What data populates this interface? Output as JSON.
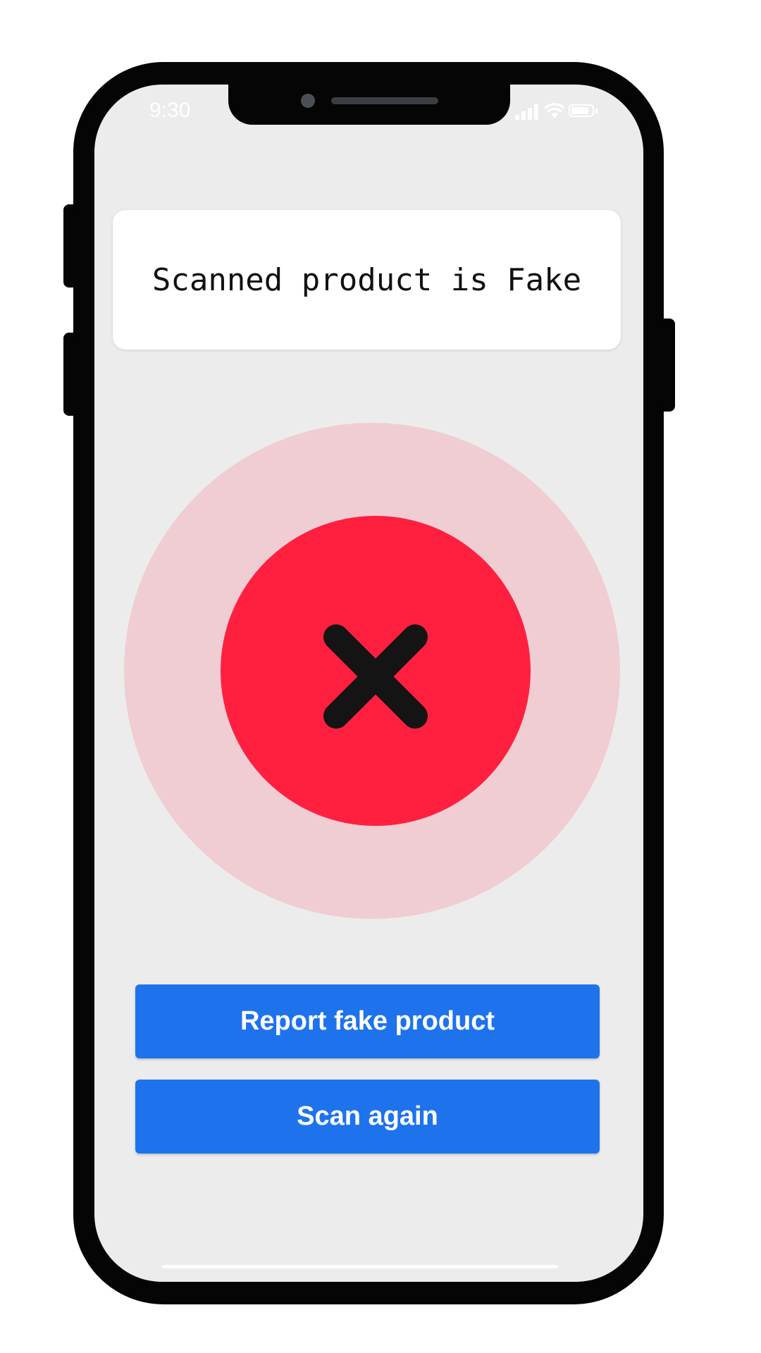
{
  "status_bar": {
    "time": "9:30"
  },
  "result": {
    "message": "Scanned product is Fake",
    "status_icon": "close-icon"
  },
  "actions": {
    "report_label": "Report fake product",
    "scan_again_label": "Scan again"
  },
  "colors": {
    "background": "#ececec",
    "accent_blue": "#1e73ec",
    "error_red": "#ff2040",
    "error_halo": "#f0cdd3",
    "mark": "#141414"
  }
}
